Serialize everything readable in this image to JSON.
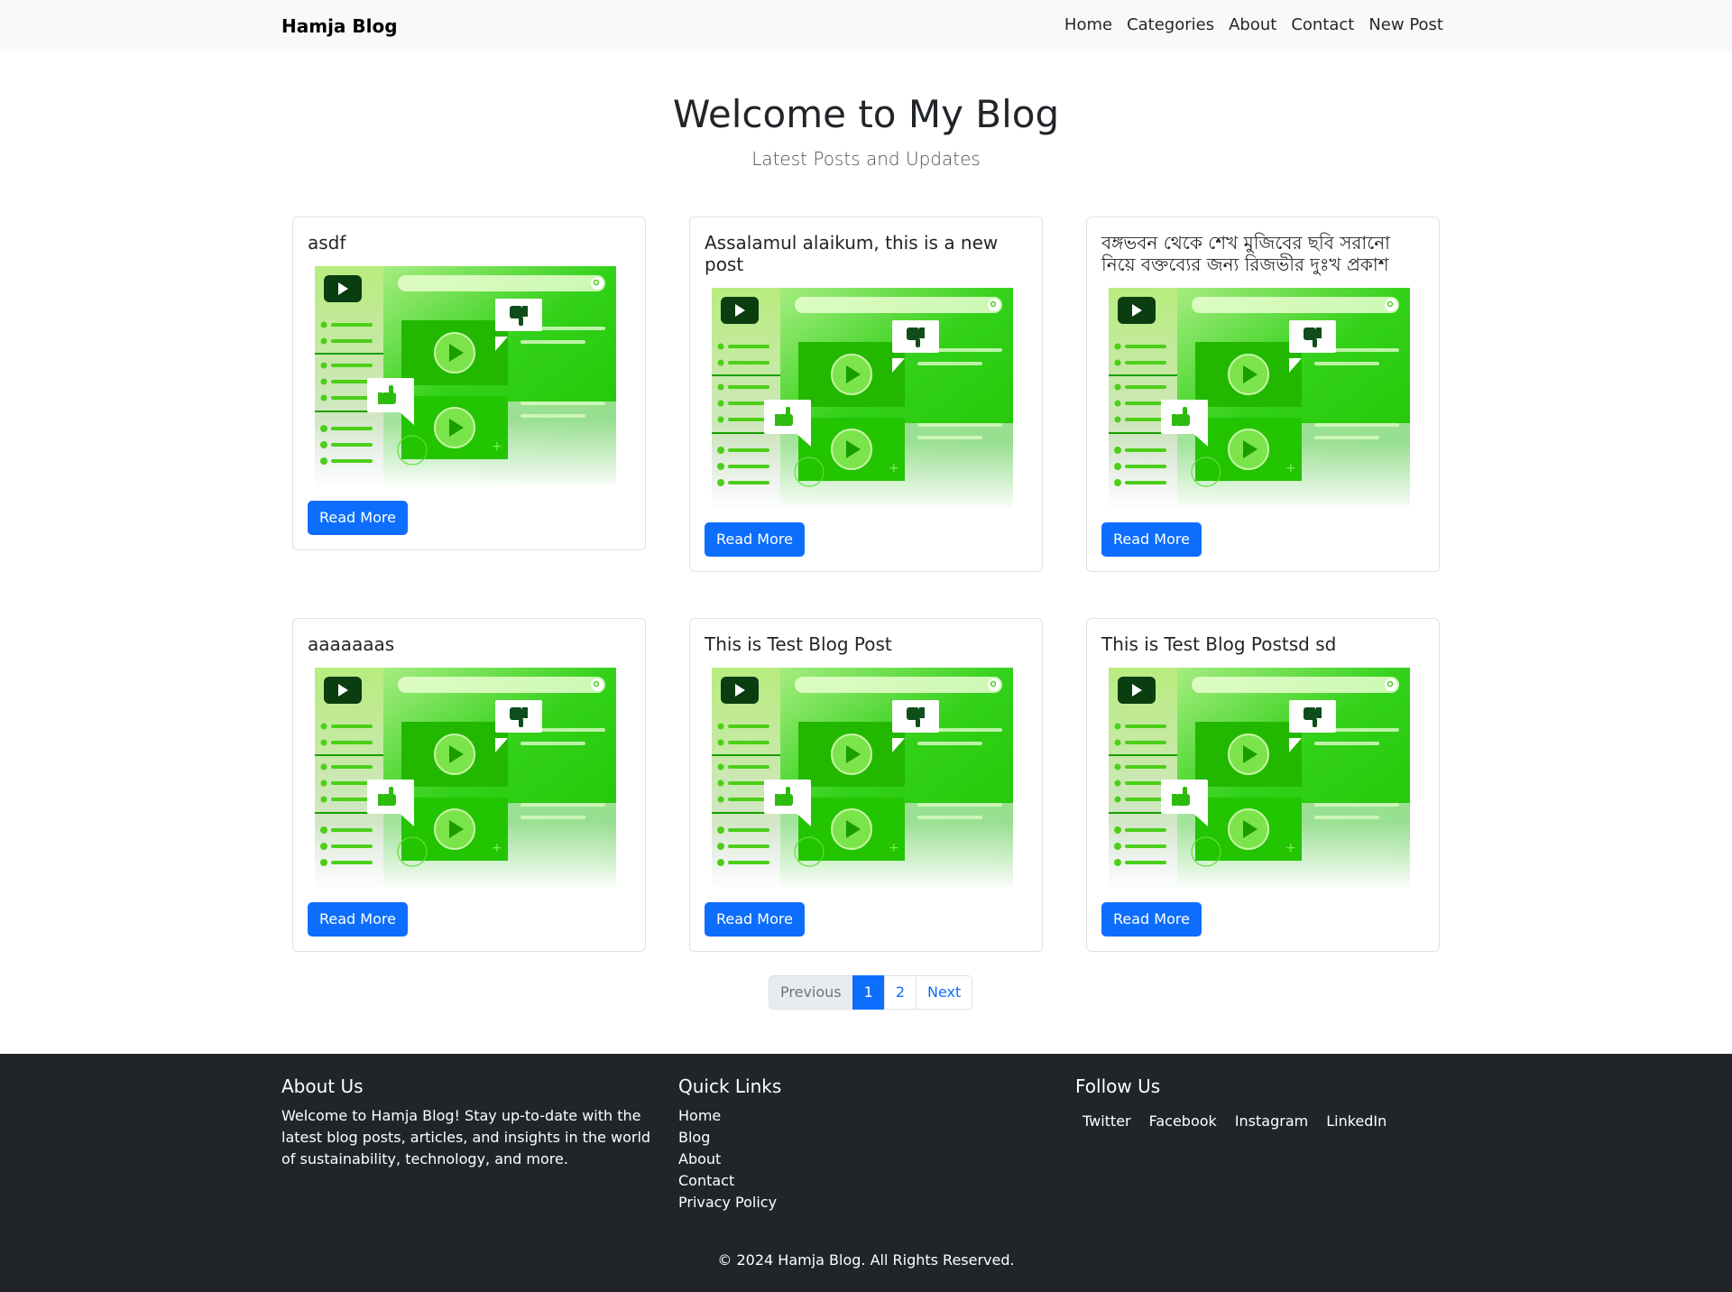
{
  "navbar": {
    "brand": "Hamja Blog",
    "links": [
      "Home",
      "Categories",
      "About",
      "Contact",
      "New Post"
    ]
  },
  "hero": {
    "title": "Welcome to My Blog",
    "subtitle": "Latest Posts and Updates"
  },
  "posts": [
    {
      "title": "asdf",
      "button": "Read More"
    },
    {
      "title": "Assalamul alaikum, this is a new post",
      "button": "Read More"
    },
    {
      "title": "বঙ্গভবন থেকে শেখ মুজিবের ছবি সরানো নিয়ে বক্তব্যের জন্য রিজভীর দুঃখ প্রকাশ",
      "button": "Read More"
    },
    {
      "title": "aaaaaaas",
      "button": "Read More"
    },
    {
      "title": "This is Test Blog Post",
      "button": "Read More"
    },
    {
      "title": "This is Test Blog Postsd sd",
      "button": "Read More"
    }
  ],
  "pagination": {
    "previous": "Previous",
    "pages": [
      "1",
      "2"
    ],
    "active_page": "1",
    "next": "Next"
  },
  "footer": {
    "about_heading": "About Us",
    "about_text": "Welcome to Hamja Blog! Stay up-to-date with the latest blog posts, articles, and insights in the world of sustainability, technology, and more.",
    "quick_links_heading": "Quick Links",
    "quick_links": [
      "Home",
      "Blog",
      "About",
      "Contact",
      "Privacy Policy"
    ],
    "follow_heading": "Follow Us",
    "social_links": [
      "Twitter",
      "Facebook",
      "Instagram",
      "LinkedIn"
    ],
    "copyright": "© 2024 Hamja Blog. All Rights Reserved."
  },
  "colors": {
    "primary": "#0d6efd",
    "navbar_bg": "#f8f9fa",
    "footer_bg": "#212529",
    "thumbnail_green": "#22c800"
  }
}
